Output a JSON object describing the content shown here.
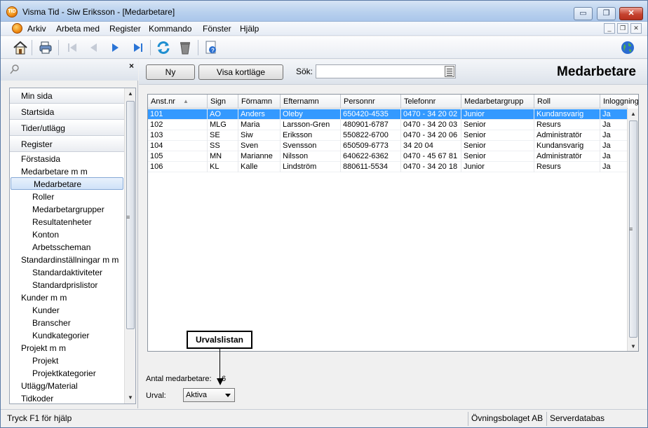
{
  "window": {
    "title": "Visma Tid - Siw Eriksson - [Medarbetare]",
    "app_icon_text": "TID",
    "minimize_label": "▭",
    "maximize_label": "❐",
    "close_label": "✕"
  },
  "menu": {
    "items": [
      "Arkiv",
      "Arbeta med",
      "Register",
      "Kommando",
      "Fönster",
      "Hjälp"
    ],
    "mdi_minimize": "_",
    "mdi_restore": "❐",
    "mdi_close": "✕"
  },
  "toolbar": {
    "buttons": [
      "home-icon",
      "print-icon",
      "first-record-icon",
      "previous-record-icon",
      "next-record-icon",
      "last-record-icon",
      "refresh-icon",
      "delete-icon",
      "help-icon",
      "globe-icon"
    ]
  },
  "left_panel": {
    "close_label": "×",
    "groups": [
      "Min sida",
      "Startsida",
      "Tider/utlägg",
      "Register"
    ],
    "items": [
      {
        "label": "Förstasida",
        "level": 1
      },
      {
        "label": "Medarbetare m m",
        "level": 1
      },
      {
        "label": "Medarbetare",
        "level": 2,
        "selected": true
      },
      {
        "label": "Roller",
        "level": 2
      },
      {
        "label": "Medarbetargrupper",
        "level": 2
      },
      {
        "label": "Resultatenheter",
        "level": 2
      },
      {
        "label": "Konton",
        "level": 2
      },
      {
        "label": "Arbetsscheman",
        "level": 2
      },
      {
        "label": "Standardinställningar m m",
        "level": 1
      },
      {
        "label": "Standardaktiviteter",
        "level": 2
      },
      {
        "label": "Standardprislistor",
        "level": 2
      },
      {
        "label": "Kunder m m",
        "level": 1
      },
      {
        "label": "Kunder",
        "level": 2
      },
      {
        "label": "Branscher",
        "level": 2
      },
      {
        "label": "Kundkategorier",
        "level": 2
      },
      {
        "label": "Projekt m m",
        "level": 1
      },
      {
        "label": "Projekt",
        "level": 2
      },
      {
        "label": "Projektkategorier",
        "level": 2
      },
      {
        "label": "Utlägg/Material",
        "level": 1
      },
      {
        "label": "Tidkoder",
        "level": 1
      }
    ]
  },
  "main": {
    "new_button": "Ny",
    "card_view_button": "Visa kortläge",
    "search_label": "Sök:",
    "search_value": "",
    "page_title": "Medarbetare",
    "columns": [
      "Anst.nr",
      "Sign",
      "Förnamn",
      "Efternamn",
      "Personnr",
      "Telefonnr",
      "Medarbetargrupp",
      "Roll",
      "Inloggning"
    ],
    "rows": [
      [
        "101",
        "AO",
        "Anders",
        "Oleby",
        "650420-4535",
        "0470 - 34 20 02",
        "Junior",
        "Kundansvarig",
        "Ja"
      ],
      [
        "102",
        "MLG",
        "Maria",
        "Larsson-Gren",
        "480901-6787",
        "0470 - 34 20 03",
        "Senior",
        "Resurs",
        "Ja"
      ],
      [
        "103",
        "SE",
        "Siw",
        "Eriksson",
        "550822-6700",
        "0470 - 34 20 06",
        "Senior",
        "Administratör",
        "Ja"
      ],
      [
        "104",
        "SS",
        "Sven",
        "Svensson",
        "650509-6773",
        "34 20 04",
        "Senior",
        "Kundansvarig",
        "Ja"
      ],
      [
        "105",
        "MN",
        "Marianne",
        "Nilsson",
        "640622-6362",
        "0470 - 45 67 81",
        "Senior",
        "Administratör",
        "Ja"
      ],
      [
        "106",
        "KL",
        "Kalle",
        "Lindström",
        "880611-5534",
        "0470 - 34 20 18",
        "Junior",
        "Resurs",
        "Ja"
      ]
    ],
    "count_label": "Antal medarbetare:",
    "count_value": "6",
    "urval_label": "Urval:",
    "urval_value": "Aktiva",
    "callout": "Urvalslistan"
  },
  "status": {
    "help_text": "Tryck F1 för hjälp",
    "company": "Övningsbolaget AB",
    "database": "Serverdatabas"
  }
}
